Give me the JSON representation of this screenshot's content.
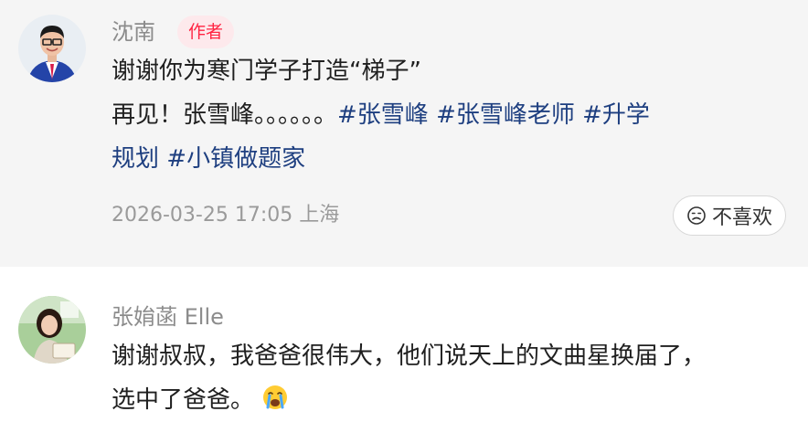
{
  "comments": [
    {
      "author": "沈南",
      "badge": "作者",
      "line1": "谢谢你为寒门学子打造“梯子”",
      "line2_text": "再见！张雪峰。。。。。。",
      "line2_tags": [
        "#张雪峰",
        "#张雪峰老师",
        "#升学"
      ],
      "line3_tags": [
        "规划",
        "#小镇做题家"
      ],
      "timestamp": "2026-03-25 17:05",
      "location": "上海",
      "dislike_label": "不喜欢",
      "dislike_icon": "frown-face-icon"
    },
    {
      "author": "张姢菡 Elle",
      "line1": "谢谢叔叔，我爸爸很伟大，他们说天上的文曲星换届了，",
      "line2": "选中了爸爸。",
      "emoji": "crying-face-icon"
    }
  ]
}
